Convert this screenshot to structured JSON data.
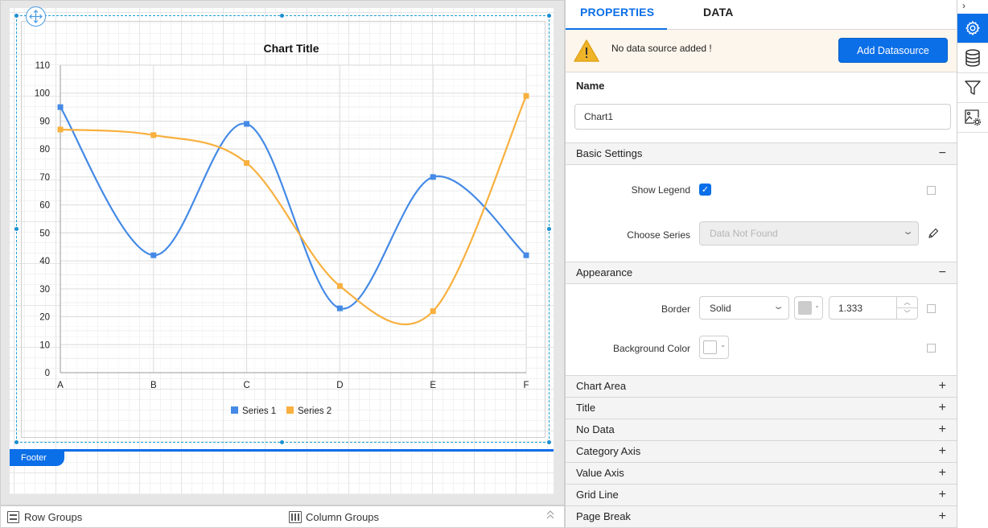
{
  "designer": {
    "footer_label": "Footer",
    "move_icon": "move-arrows-icon"
  },
  "chart_data": {
    "type": "line",
    "title": "Chart Title",
    "xlabel": "",
    "ylabel": "",
    "categories": [
      "A",
      "B",
      "C",
      "D",
      "E",
      "F"
    ],
    "series": [
      {
        "name": "Series 1",
        "color": "#448ae6",
        "values": [
          95,
          42,
          89,
          23,
          70,
          42
        ]
      },
      {
        "name": "Series 2",
        "color": "#f8b03e",
        "values": [
          87,
          85,
          75,
          31,
          22,
          99
        ]
      }
    ],
    "ylim": [
      0,
      110
    ],
    "yticks": [
      0,
      10,
      20,
      30,
      40,
      50,
      60,
      70,
      80,
      90,
      100,
      110
    ],
    "smooth": true,
    "markers": "square",
    "grid": true,
    "legend": "bottom-center"
  },
  "groups": {
    "row_groups": "Row Groups",
    "column_groups": "Column Groups"
  },
  "panel": {
    "tabs": [
      {
        "label": "PROPERTIES",
        "active": true
      },
      {
        "label": "DATA",
        "active": false
      }
    ],
    "alert": {
      "message": "No data source added !",
      "button": "Add Datasource"
    },
    "name": {
      "label": "Name",
      "value": "Chart1"
    },
    "basic_settings": {
      "title": "Basic Settings",
      "toggle": "−",
      "show_legend_label": "Show Legend",
      "show_legend_checked": true,
      "choose_series_label": "Choose Series",
      "choose_series_placeholder": "Data Not Found"
    },
    "appearance": {
      "title": "Appearance",
      "toggle": "−",
      "border_label": "Border",
      "border_style": "Solid",
      "border_color": "#cccccc",
      "border_width": "1.333",
      "background_label": "Background Color",
      "background_color": "#ffffff"
    },
    "collapsed_sections": [
      {
        "title": "Chart Area",
        "toggle": "+"
      },
      {
        "title": "Title",
        "toggle": "+"
      },
      {
        "title": "No Data",
        "toggle": "+"
      },
      {
        "title": "Category Axis",
        "toggle": "+"
      },
      {
        "title": "Value Axis",
        "toggle": "+"
      },
      {
        "title": "Grid Line",
        "toggle": "+"
      },
      {
        "title": "Page Break",
        "toggle": "+"
      }
    ]
  },
  "sidebar_strip": {
    "collapse": "›",
    "items": [
      {
        "name": "properties",
        "icon": "gear-icon",
        "active": true
      },
      {
        "name": "data",
        "icon": "database-icon",
        "active": false
      },
      {
        "name": "filter",
        "icon": "filter-icon",
        "active": false
      },
      {
        "name": "image-settings",
        "icon": "image-settings-icon",
        "active": false
      }
    ]
  },
  "colors": {
    "accent": "#0b6fe8",
    "alert_bg": "#fdf6ec",
    "warning": "#f0b429"
  }
}
